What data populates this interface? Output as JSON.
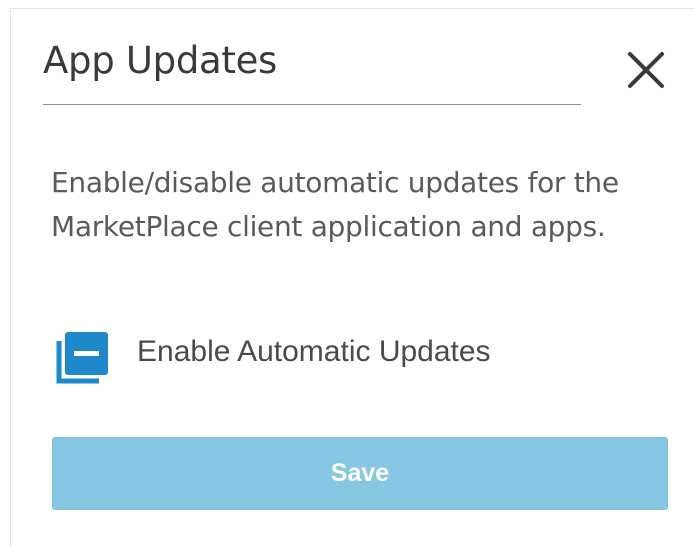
{
  "dialog": {
    "title": "App Updates",
    "close_icon": "close-icon",
    "description": "Enable/disable automatic updates for the MarketPlace client application and apps.",
    "toggle": {
      "icon": "collapse-square-icon",
      "label": "Enable Automatic Updates",
      "state": "indeterminate"
    },
    "save_label": "Save"
  },
  "colors": {
    "accent": "#1e88c8",
    "save_button_bg": "#86c8e3",
    "text": "#5a5a5a"
  }
}
